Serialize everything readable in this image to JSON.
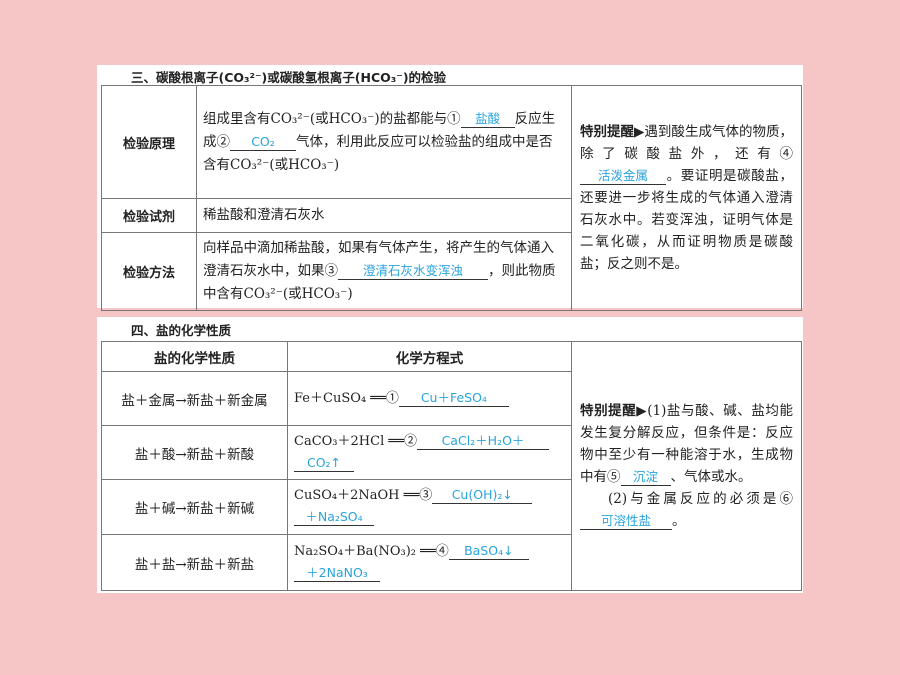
{
  "section3": {
    "title": "三、碳酸根离子(CO₃²⁻)或碳酸氢根离子(HCO₃⁻)的检验",
    "rows": [
      {
        "label": "检验原理",
        "text_a": "组成里含有CO₃²⁻(或HCO₃⁻)的盐都能与①",
        "blank1": "盐酸",
        "text_b": "反应生成②",
        "blank2": "CO₂",
        "text_c": "气体，利用此反应可以检验盐的组成中是否含有CO₃²⁻(或HCO₃⁻)"
      },
      {
        "label": "检验试剂",
        "text": "稀盐酸和澄清石灰水"
      },
      {
        "label": "检验方法",
        "text_a": "向样品中滴加稀盐酸，如果有气体产生，将产生的气体通入澄清石灰水中，如果③",
        "blank": "澄清石灰水变浑浊",
        "text_b": "，则此物质中含有CO₃²⁻(或HCO₃⁻)"
      }
    ],
    "tip": {
      "head": "特别提醒▶",
      "text_a": "遇到酸生成气体的物质，除了碳酸盐外，还有④",
      "blank": "活泼金属",
      "text_b": "。要证明是碳酸盐，还要进一步将生成的气体通入澄清石灰水中。若变浑浊，证明气体是二氧化碳，从而证明物质是碳酸盐；反之则不是。"
    }
  },
  "section4": {
    "title": "四、盐的化学性质",
    "headers": {
      "property": "盐的化学性质",
      "equation": "化学方程式"
    },
    "rows": [
      {
        "property": "盐＋金属→新盐＋新金属",
        "equation": "Fe＋CuSO₄ ══①",
        "answer": "Cu＋FeSO₄",
        "answer2": ""
      },
      {
        "property": "盐＋酸→新盐＋新酸",
        "equation": "CaCO₃＋2HCl ══②",
        "answer": "CaCl₂＋H₂O＋",
        "answer2": "CO₂↑"
      },
      {
        "property": "盐＋碱→新盐＋新碱",
        "equation": "CuSO₄＋2NaOH ══③",
        "answer": "Cu(OH)₂↓",
        "answer2": "＋Na₂SO₄"
      },
      {
        "property": "盐＋盐→新盐＋新盐",
        "equation": "Na₂SO₄＋Ba(NO₃)₂ ══④",
        "answer": "BaSO₄↓",
        "answer2": "＋2NaNO₃"
      }
    ],
    "tip": {
      "head": "特别提醒▶",
      "text_a": "(1)盐与酸、碱、盐均能发生复分解反应，但条件是：反应物中至少有一种能溶于水，生成物中有⑤",
      "blank1": "沉淀",
      "text_b": "、气体或水。",
      "text_c": "(2)与金属反应的必须是⑥",
      "blank2": "可溶性盐",
      "text_d": "。"
    }
  },
  "colors": {
    "background": "#f6c6c6",
    "answer": "#2aa3dc"
  }
}
